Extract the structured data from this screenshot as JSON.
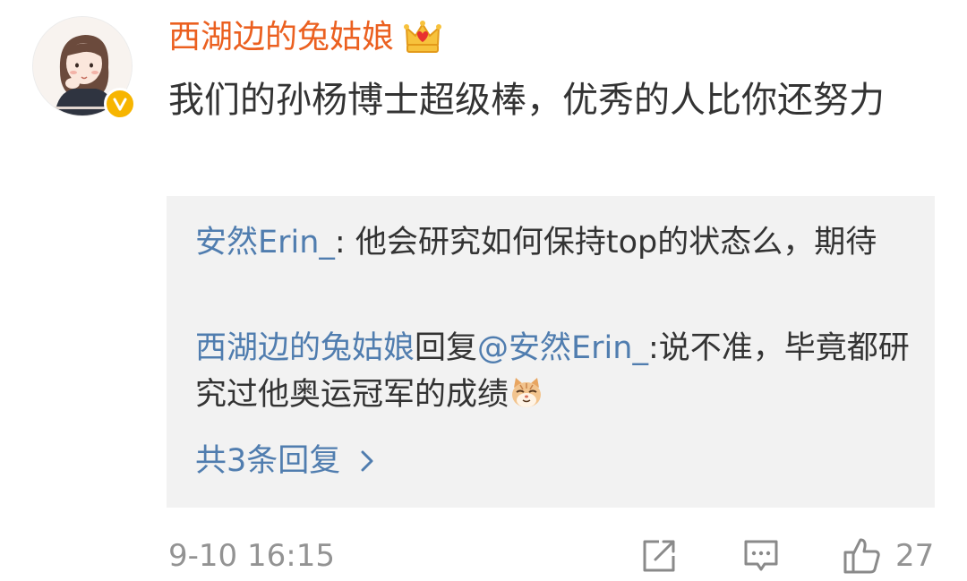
{
  "comment": {
    "username": "西湖边的兔姑娘",
    "text": "我们的孙杨博士超级棒，优秀的人比你还努力",
    "timestamp": "9-10 16:15",
    "like_count": "27"
  },
  "replies": [
    {
      "author": "安然Erin_",
      "separator": ": ",
      "text": "他会研究如何保持top的状态么，期待"
    },
    {
      "author": "西湖边的兔姑娘",
      "reply_word": "回复",
      "mention": "@安然Erin_",
      "separator": ":",
      "text": "说不准，毕竟都研究过他奥运冠军的成绩"
    }
  ],
  "more_replies": "共3条回复",
  "colors": {
    "username": "#eb6020",
    "link": "#507daf",
    "reply_bg": "#f2f2f2",
    "meta": "#939393",
    "badge": "#f7b500"
  },
  "icons": {
    "crown": "crown-icon",
    "verified": "verified-badge-icon",
    "cat_emoji": "cat-emoji-icon",
    "chevron": "chevron-right-icon",
    "share": "share-icon",
    "comment": "comment-icon",
    "like": "thumbs-up-icon"
  }
}
